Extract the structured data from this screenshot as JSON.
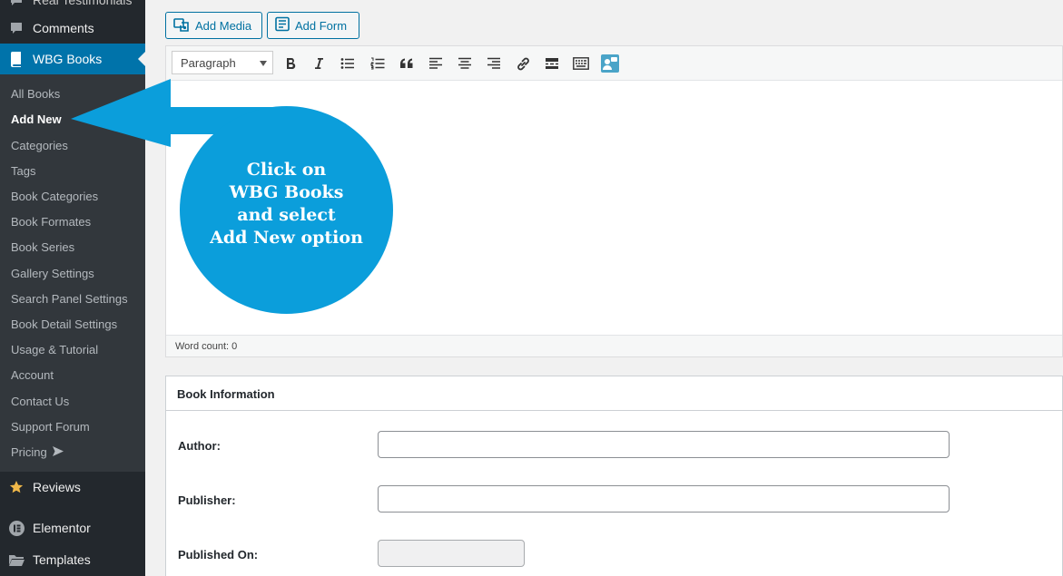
{
  "sidebar": {
    "top_items": [
      {
        "label": "Real Testimonials",
        "icon": "testimonial-icon"
      },
      {
        "label": "Comments",
        "icon": "comment-bubble-icon"
      },
      {
        "label": "WBG Books",
        "icon": "book-icon"
      }
    ],
    "submenu": [
      "All Books",
      "Add New",
      "Categories",
      "Tags",
      "Book Categories",
      "Book Formates",
      "Book Series",
      "Gallery Settings",
      "Search Panel Settings",
      "Book Detail Settings",
      "Usage & Tutorial",
      "Account",
      "Contact Us",
      "Support Forum",
      "Pricing"
    ],
    "current_submenu": "Add New",
    "bottom_items": [
      {
        "label": "Reviews",
        "icon": "star-icon"
      },
      {
        "label": "Elementor",
        "icon": "elementor-icon"
      },
      {
        "label": "Templates",
        "icon": "folder-icon"
      }
    ]
  },
  "editor": {
    "add_media_label": "Add Media",
    "add_form_label": "Add Form",
    "format_select_value": "Paragraph",
    "toolbar_icons": [
      "bold-icon",
      "italic-icon",
      "bullet-list-icon",
      "numbered-list-icon",
      "blockquote-icon",
      "align-left-icon",
      "align-center-icon",
      "align-right-icon",
      "link-icon",
      "read-more-icon",
      "toolbar-toggle-icon",
      "contact-card-icon"
    ],
    "word_count": "Word count: 0"
  },
  "book_information": {
    "title": "Book Information",
    "fields": [
      {
        "label": "Author:",
        "value": ""
      },
      {
        "label": "Publisher:",
        "value": ""
      },
      {
        "label": "Published On:",
        "value": ""
      }
    ]
  },
  "callout": {
    "lines": [
      "Click on",
      "WBG Books",
      "and select",
      "Add New option"
    ],
    "color": "#0b9edb"
  },
  "colors": {
    "sidebar_bg": "#23282d",
    "submenu_bg": "#32373c",
    "active_menu": "#0073aa",
    "button_accent": "#0071a1"
  }
}
